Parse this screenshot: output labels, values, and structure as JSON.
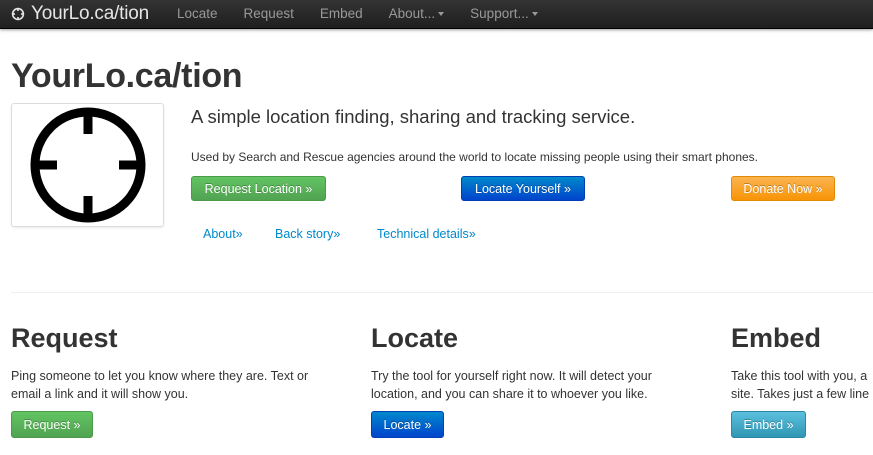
{
  "nav": {
    "brand": "YourLo.ca/tion",
    "items": [
      {
        "label": "Locate",
        "dropdown": false
      },
      {
        "label": "Request",
        "dropdown": false
      },
      {
        "label": "Embed",
        "dropdown": false
      },
      {
        "label": "About...",
        "dropdown": true
      },
      {
        "label": "Support...",
        "dropdown": true
      }
    ]
  },
  "hero": {
    "title": "YourLo.ca/tion",
    "tagline": "A simple location finding, sharing and tracking service.",
    "description": "Used by Search and Rescue agencies around the world to locate missing people using their smart phones.",
    "buttons": {
      "request": "Request Location »",
      "locate": "Locate Yourself »",
      "donate": "Donate Now »"
    },
    "links": {
      "about": "About»",
      "back_story": "Back story»",
      "technical": "Technical details»"
    }
  },
  "columns": [
    {
      "title": "Request",
      "line1": "Ping someone to let you know where they are. Text or",
      "line2": "email a link and it will show you.",
      "button": "Request »"
    },
    {
      "title": "Locate",
      "line1": "Try the tool for yourself right now. It will detect your",
      "line2": "location, and you can share it to whoever you like.",
      "button": "Locate »"
    },
    {
      "title": "Embed",
      "line1": "Take this tool with you, a",
      "line2": "site. Takes just a few line",
      "button": "Embed »"
    }
  ],
  "colors": {
    "navbar": "#222222",
    "link": "#0088cc",
    "success": "#5bb75b",
    "primary": "#006dcc",
    "warning": "#faa732",
    "info": "#49afcd"
  },
  "icons": {
    "brand": "crosshair-icon",
    "logo": "crosshair-icon"
  }
}
